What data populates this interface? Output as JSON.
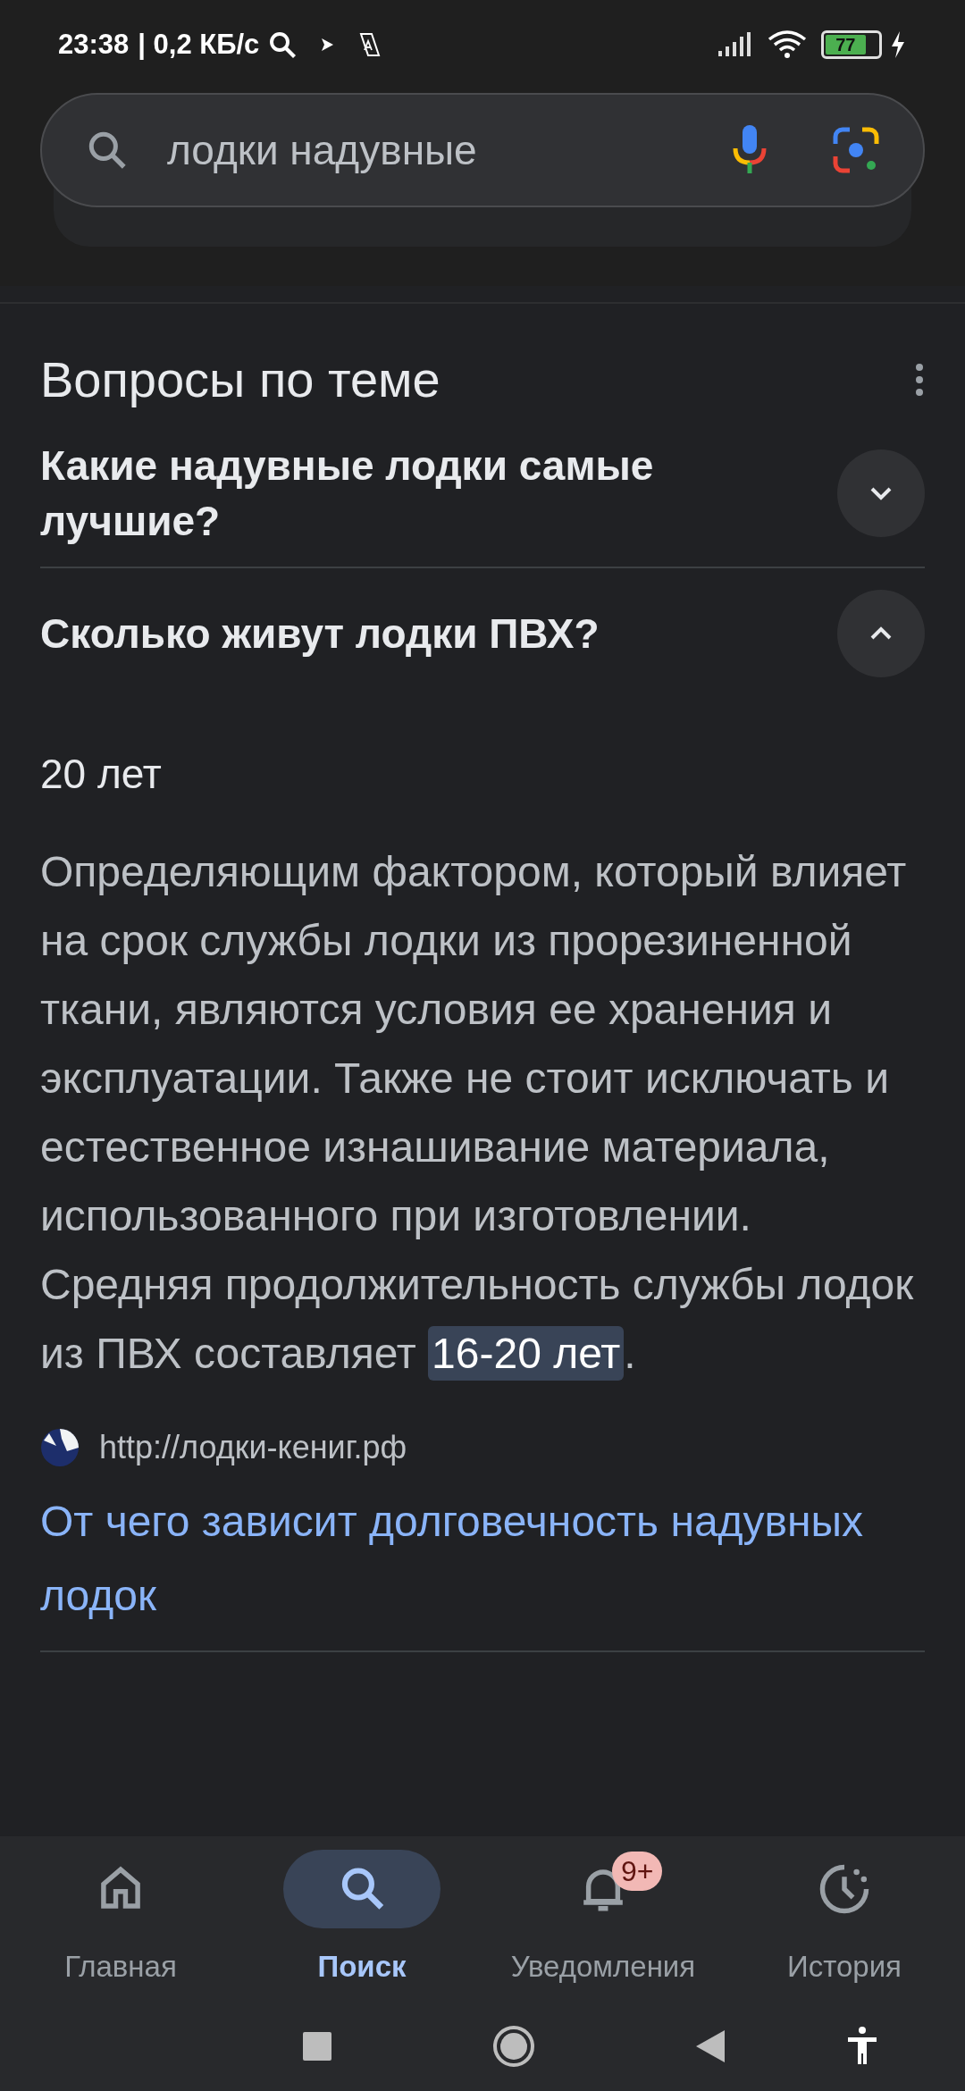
{
  "status_bar": {
    "time": "23:38",
    "speed": "| 0,2 КБ/с",
    "battery": "77"
  },
  "search": {
    "value": "лодки надувные"
  },
  "section": {
    "title": "Вопросы по теме",
    "questions": [
      {
        "text": "Какие надувные лодки самые лучшие?",
        "expanded": false
      },
      {
        "text": "Сколько живут лодки ПВХ?",
        "expanded": true,
        "answer": {
          "short": "20 лет",
          "text": "Определяющим фактором, который влияет на срок службы лодки из прорезиненной ткани, являются условия ее хранения и эксплуатации. Также не стоит исключать и естественное изнашивание материала, использованного при изготовлении. Средняя продолжительность службы лодок из ПВХ составляет ",
          "highlight": "16-20 лет",
          "after": ".",
          "source": "http://лодки-кениг.рф",
          "link": "От чего зависит долговечность надувных лодок"
        }
      }
    ]
  },
  "bottom_nav": [
    {
      "label": "Главная",
      "kind": "home",
      "selected": false
    },
    {
      "label": "Поиск",
      "kind": "search",
      "selected": true
    },
    {
      "label": "Уведомления",
      "kind": "bell",
      "selected": false,
      "badge": "9+"
    },
    {
      "label": "История",
      "kind": "history",
      "selected": false
    }
  ]
}
